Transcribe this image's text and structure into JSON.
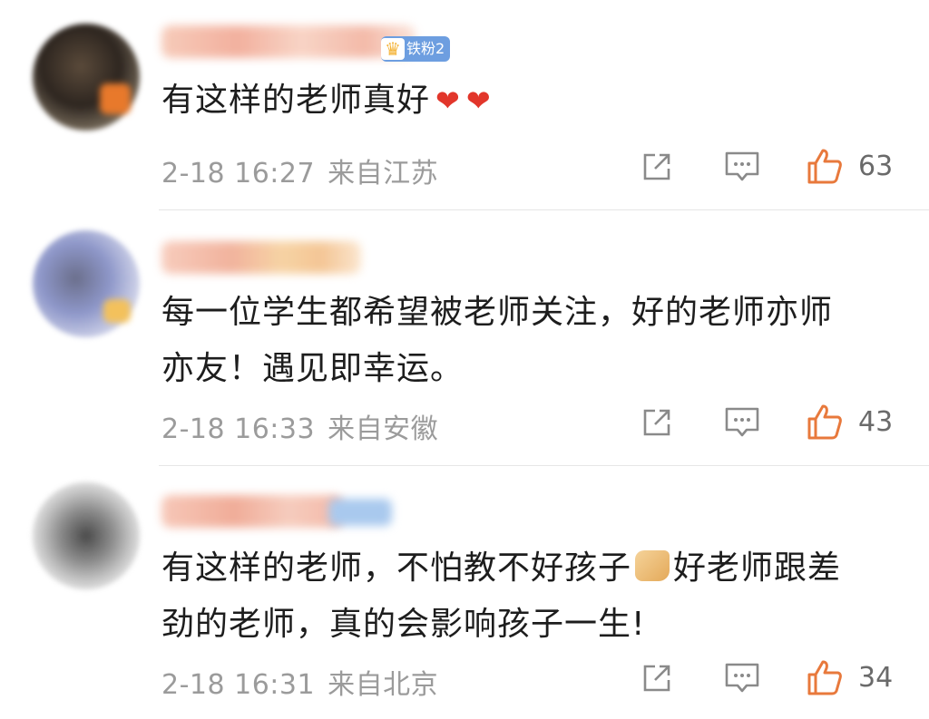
{
  "comments": [
    {
      "badge": "铁粉2",
      "text_lines": [
        "有这样的老师真好"
      ],
      "reactions": [
        "heart",
        "heart"
      ],
      "date": "2-18 16:27",
      "location": "来自江苏",
      "likes": "63"
    },
    {
      "text_lines": [
        "每一位学生都希望被老师关注，好的老师亦师",
        "亦友！遇见即幸运。"
      ],
      "date": "2-18 16:33",
      "location": "来自安徽",
      "likes": "43"
    },
    {
      "text_lines_pre": "有这样的老师，不怕教不好孩子",
      "emoji": "thumbs-up",
      "text_lines_post": "好老师跟差",
      "text_line_2": "劲的老师，真的会影响孩子一生!",
      "date": "2-18 16:31",
      "location": "来自北京",
      "likes": "34"
    }
  ],
  "colors": {
    "like_orange": "#e8793c",
    "meta_gray": "#9b9b9b",
    "icon_gray": "#8a8a8a",
    "badge_blue": "#6d9ee0",
    "heart_red": "#e2362b"
  },
  "icons": [
    "share-icon",
    "comment-icon",
    "like-icon",
    "heart-icon",
    "crown-icon",
    "thumbs-up-emoji"
  ]
}
